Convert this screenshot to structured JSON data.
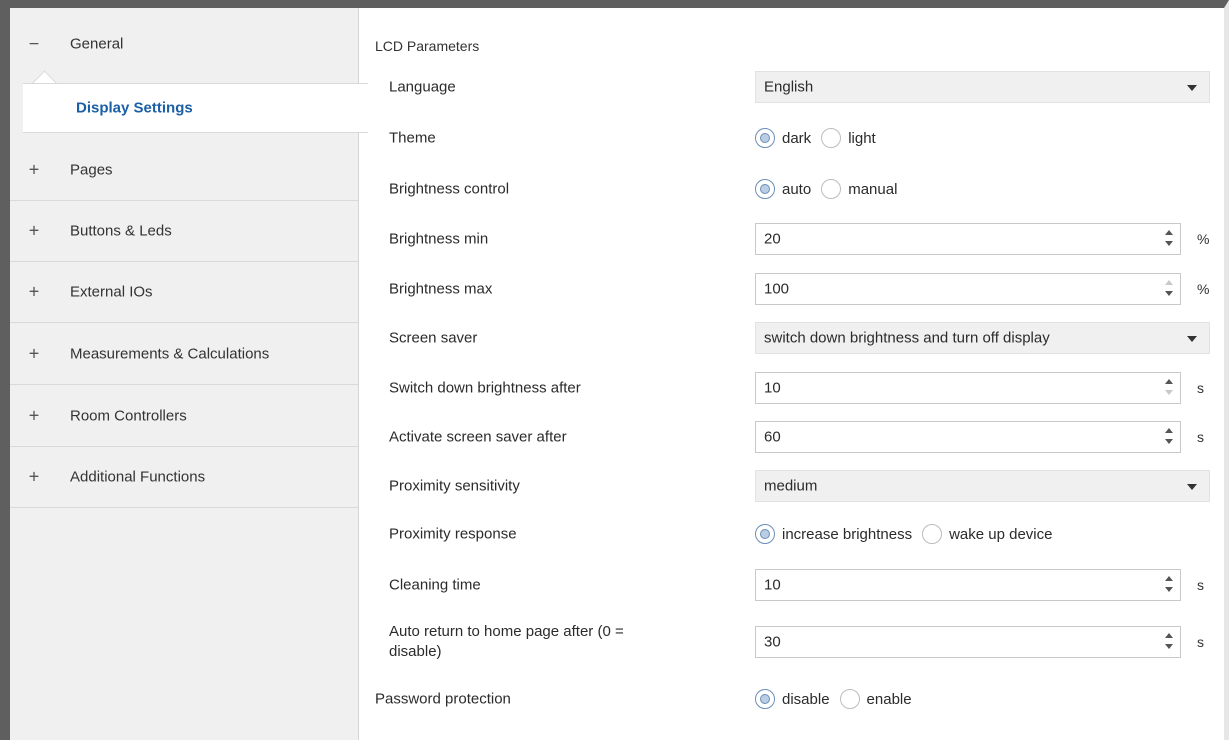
{
  "sidebar": {
    "items": [
      {
        "sign": "−",
        "label": "General"
      },
      {
        "sign": "+",
        "label": "Pages"
      },
      {
        "sign": "+",
        "label": "Buttons & Leds"
      },
      {
        "sign": "+",
        "label": "External IOs"
      },
      {
        "sign": "+",
        "label": "Measurements & Calculations"
      },
      {
        "sign": "+",
        "label": "Room Controllers"
      },
      {
        "sign": "+",
        "label": "Additional Functions"
      }
    ],
    "selected_sub": "Display Settings"
  },
  "main": {
    "section_title": "LCD Parameters",
    "language": {
      "label": "Language",
      "value": "English"
    },
    "theme": {
      "label": "Theme",
      "options": [
        "dark",
        "light"
      ],
      "selected": "dark"
    },
    "brightness_control": {
      "label": "Brightness control",
      "options": [
        "auto",
        "manual"
      ],
      "selected": "auto"
    },
    "brightness_min": {
      "label": "Brightness min",
      "value": "20",
      "unit": "%"
    },
    "brightness_max": {
      "label": "Brightness max",
      "value": "100",
      "unit": "%"
    },
    "screen_saver": {
      "label": "Screen saver",
      "value": "switch down brightness and turn off display"
    },
    "switch_down_after": {
      "label": "Switch down brightness after",
      "value": "10",
      "unit": "s"
    },
    "activate_saver_after": {
      "label": "Activate screen saver after",
      "value": "60",
      "unit": "s"
    },
    "proximity_sensitivity": {
      "label": "Proximity sensitivity",
      "value": "medium"
    },
    "proximity_response": {
      "label": "Proximity response",
      "options": [
        "increase brightness",
        "wake up device"
      ],
      "selected": "increase brightness"
    },
    "cleaning_time": {
      "label": "Cleaning time",
      "value": "10",
      "unit": "s"
    },
    "auto_return": {
      "label": "Auto return to home page after (0 = disable)",
      "value": "30",
      "unit": "s"
    },
    "password_protection": {
      "label": "Password protection",
      "options": [
        "disable",
        "enable"
      ],
      "selected": "disable"
    }
  },
  "colors": {
    "accent_text": "#1b5fa6",
    "sidebar_bg": "#f0f0f0",
    "frame": "#5f5f5f"
  }
}
